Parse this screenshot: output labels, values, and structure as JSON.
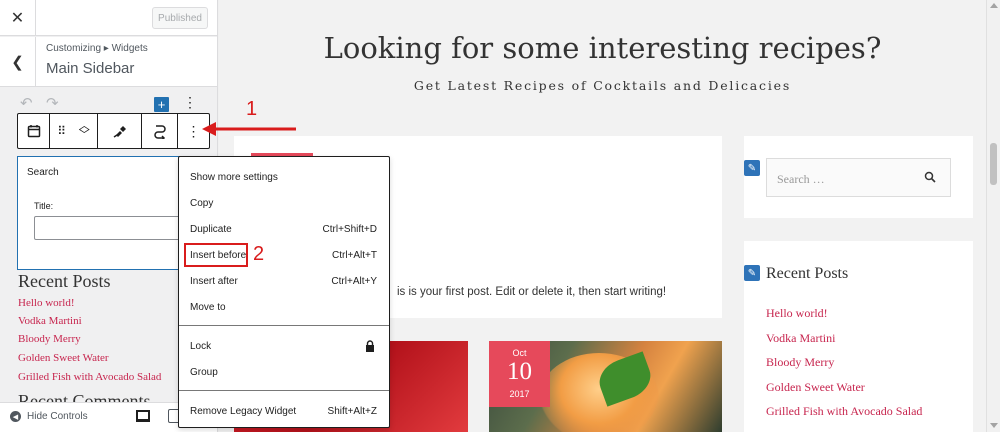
{
  "customizer": {
    "close_icon": "close-icon",
    "publish_label": "Published",
    "breadcrumb": "Customizing ▸ Widgets",
    "panel_title": "Main Sidebar",
    "hide_controls_label": "Hide Controls"
  },
  "block": {
    "name": "Search",
    "title_label": "Title:",
    "title_value": ""
  },
  "sidebar_preview": {
    "recent_title": "Recent Posts",
    "posts": [
      "Hello world!",
      "Vodka Martini",
      "Bloody Merry",
      "Golden Sweet Water",
      "Grilled Fish with Avocado Salad"
    ],
    "comments_title": "Recent Comments"
  },
  "menu": {
    "items": [
      {
        "label": "Show more settings",
        "shortcut": ""
      },
      {
        "label": "Copy",
        "shortcut": ""
      },
      {
        "label": "Duplicate",
        "shortcut": "Ctrl+Shift+D"
      },
      {
        "label": "Insert before",
        "shortcut": "Ctrl+Alt+T"
      },
      {
        "label": "Insert after",
        "shortcut": "Ctrl+Alt+Y"
      },
      {
        "label": "Move to",
        "shortcut": ""
      },
      {
        "label": "Lock",
        "shortcut": ""
      },
      {
        "label": "Group",
        "shortcut": ""
      },
      {
        "label": "Remove Legacy Widget",
        "shortcut": "Shift+Alt+Z"
      }
    ]
  },
  "annotations": {
    "step1": "1",
    "step2": "2",
    "color": "#d91c1c"
  },
  "site": {
    "title": "Looking for some interesting recipes?",
    "tagline": "Get Latest Recipes of Cocktails and Delicacies",
    "post_excerpt": "is is your first post. Edit or delete it, then start writing!",
    "date_badge": {
      "month": "Oct",
      "day": "10",
      "year": "2017"
    },
    "search_placeholder": "Search …",
    "recent_title": "Recent Posts",
    "recent_posts": [
      "Hello world!",
      "Vodka Martini",
      "Bloody Merry",
      "Golden Sweet Water",
      "Grilled Fish with Avocado Salad"
    ],
    "accent_color": "#e6495b",
    "link_color": "#c7254e"
  }
}
